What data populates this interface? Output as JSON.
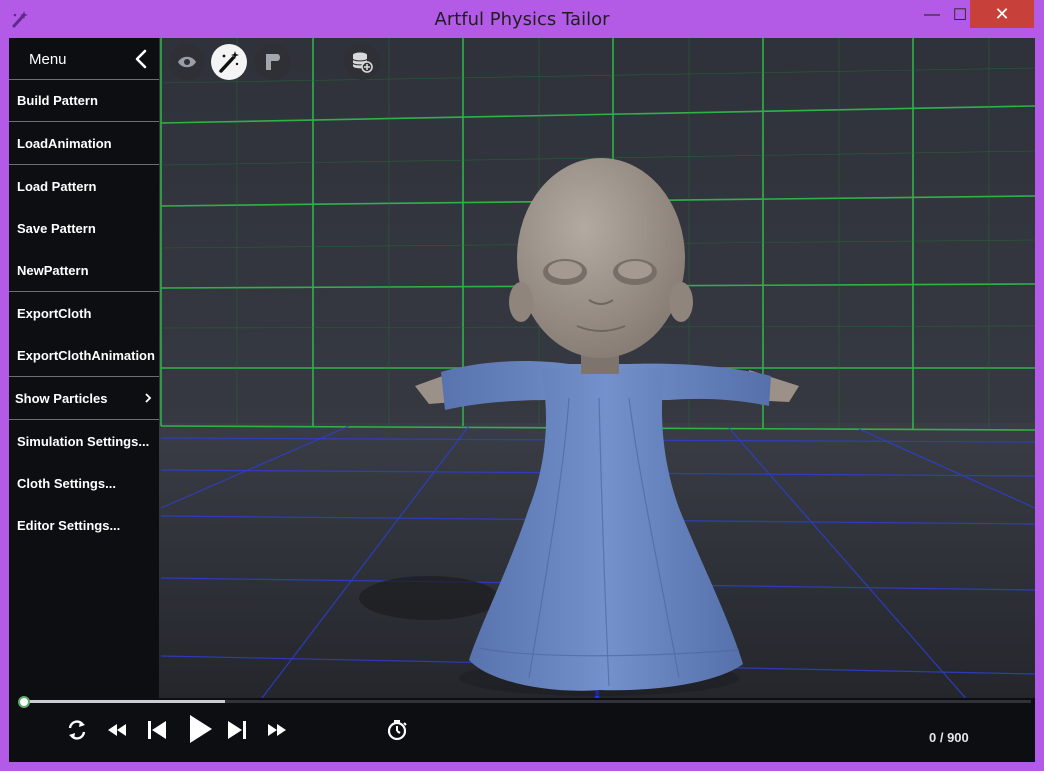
{
  "window": {
    "title": "Artful Physics Tailor",
    "icon": "magic-wand-icon",
    "controls": {
      "minimize": "—",
      "maximize": "☐",
      "close": "✕"
    }
  },
  "menu": {
    "title": "Menu",
    "items": [
      {
        "label": "Build Pattern"
      },
      {
        "label": "LoadAnimation"
      },
      {
        "label": "Load Pattern"
      },
      {
        "label": "Save Pattern"
      },
      {
        "label": "NewPattern"
      },
      {
        "label": "ExportCloth"
      },
      {
        "label": "ExportClothAnimation"
      },
      {
        "label": "Show Particles"
      },
      {
        "label": "Simulation Settings..."
      },
      {
        "label": "Cloth Settings..."
      },
      {
        "label": "Editor Settings..."
      }
    ]
  },
  "toolbar": {
    "tools": [
      "eye-icon",
      "magic-wand-icon",
      "brush-icon",
      "database-add-icon"
    ],
    "active": "magic-wand-icon"
  },
  "playback": {
    "progress": 0.2,
    "frame_counter": "0 / 900",
    "buttons": [
      "loop-icon",
      "rewind-icon",
      "skip-back-icon",
      "play-icon",
      "skip-forward-icon",
      "fast-forward-icon",
      "timer-icon"
    ]
  },
  "colors": {
    "frame": "#b35be6",
    "close": "#c7403a",
    "grid_back": "#2fbf4a",
    "grid_floor": "#2d3fd0",
    "cloth": "#6a86c0",
    "skin": "#9b9189"
  }
}
